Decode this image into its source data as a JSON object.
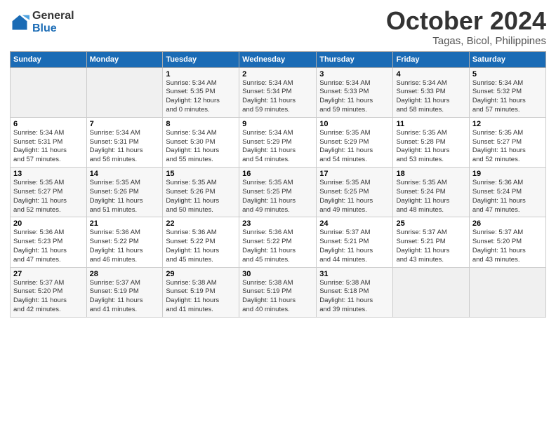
{
  "logo": {
    "general": "General",
    "blue": "Blue"
  },
  "header": {
    "month_title": "October 2024",
    "location": "Tagas, Bicol, Philippines"
  },
  "columns": [
    "Sunday",
    "Monday",
    "Tuesday",
    "Wednesday",
    "Thursday",
    "Friday",
    "Saturday"
  ],
  "weeks": [
    [
      {
        "day": "",
        "detail": ""
      },
      {
        "day": "",
        "detail": ""
      },
      {
        "day": "1",
        "detail": "Sunrise: 5:34 AM\nSunset: 5:35 PM\nDaylight: 12 hours\nand 0 minutes."
      },
      {
        "day": "2",
        "detail": "Sunrise: 5:34 AM\nSunset: 5:34 PM\nDaylight: 11 hours\nand 59 minutes."
      },
      {
        "day": "3",
        "detail": "Sunrise: 5:34 AM\nSunset: 5:33 PM\nDaylight: 11 hours\nand 59 minutes."
      },
      {
        "day": "4",
        "detail": "Sunrise: 5:34 AM\nSunset: 5:33 PM\nDaylight: 11 hours\nand 58 minutes."
      },
      {
        "day": "5",
        "detail": "Sunrise: 5:34 AM\nSunset: 5:32 PM\nDaylight: 11 hours\nand 57 minutes."
      }
    ],
    [
      {
        "day": "6",
        "detail": "Sunrise: 5:34 AM\nSunset: 5:31 PM\nDaylight: 11 hours\nand 57 minutes."
      },
      {
        "day": "7",
        "detail": "Sunrise: 5:34 AM\nSunset: 5:31 PM\nDaylight: 11 hours\nand 56 minutes."
      },
      {
        "day": "8",
        "detail": "Sunrise: 5:34 AM\nSunset: 5:30 PM\nDaylight: 11 hours\nand 55 minutes."
      },
      {
        "day": "9",
        "detail": "Sunrise: 5:34 AM\nSunset: 5:29 PM\nDaylight: 11 hours\nand 54 minutes."
      },
      {
        "day": "10",
        "detail": "Sunrise: 5:35 AM\nSunset: 5:29 PM\nDaylight: 11 hours\nand 54 minutes."
      },
      {
        "day": "11",
        "detail": "Sunrise: 5:35 AM\nSunset: 5:28 PM\nDaylight: 11 hours\nand 53 minutes."
      },
      {
        "day": "12",
        "detail": "Sunrise: 5:35 AM\nSunset: 5:27 PM\nDaylight: 11 hours\nand 52 minutes."
      }
    ],
    [
      {
        "day": "13",
        "detail": "Sunrise: 5:35 AM\nSunset: 5:27 PM\nDaylight: 11 hours\nand 52 minutes."
      },
      {
        "day": "14",
        "detail": "Sunrise: 5:35 AM\nSunset: 5:26 PM\nDaylight: 11 hours\nand 51 minutes."
      },
      {
        "day": "15",
        "detail": "Sunrise: 5:35 AM\nSunset: 5:26 PM\nDaylight: 11 hours\nand 50 minutes."
      },
      {
        "day": "16",
        "detail": "Sunrise: 5:35 AM\nSunset: 5:25 PM\nDaylight: 11 hours\nand 49 minutes."
      },
      {
        "day": "17",
        "detail": "Sunrise: 5:35 AM\nSunset: 5:25 PM\nDaylight: 11 hours\nand 49 minutes."
      },
      {
        "day": "18",
        "detail": "Sunrise: 5:35 AM\nSunset: 5:24 PM\nDaylight: 11 hours\nand 48 minutes."
      },
      {
        "day": "19",
        "detail": "Sunrise: 5:36 AM\nSunset: 5:24 PM\nDaylight: 11 hours\nand 47 minutes."
      }
    ],
    [
      {
        "day": "20",
        "detail": "Sunrise: 5:36 AM\nSunset: 5:23 PM\nDaylight: 11 hours\nand 47 minutes."
      },
      {
        "day": "21",
        "detail": "Sunrise: 5:36 AM\nSunset: 5:22 PM\nDaylight: 11 hours\nand 46 minutes."
      },
      {
        "day": "22",
        "detail": "Sunrise: 5:36 AM\nSunset: 5:22 PM\nDaylight: 11 hours\nand 45 minutes."
      },
      {
        "day": "23",
        "detail": "Sunrise: 5:36 AM\nSunset: 5:22 PM\nDaylight: 11 hours\nand 45 minutes."
      },
      {
        "day": "24",
        "detail": "Sunrise: 5:37 AM\nSunset: 5:21 PM\nDaylight: 11 hours\nand 44 minutes."
      },
      {
        "day": "25",
        "detail": "Sunrise: 5:37 AM\nSunset: 5:21 PM\nDaylight: 11 hours\nand 43 minutes."
      },
      {
        "day": "26",
        "detail": "Sunrise: 5:37 AM\nSunset: 5:20 PM\nDaylight: 11 hours\nand 43 minutes."
      }
    ],
    [
      {
        "day": "27",
        "detail": "Sunrise: 5:37 AM\nSunset: 5:20 PM\nDaylight: 11 hours\nand 42 minutes."
      },
      {
        "day": "28",
        "detail": "Sunrise: 5:37 AM\nSunset: 5:19 PM\nDaylight: 11 hours\nand 41 minutes."
      },
      {
        "day": "29",
        "detail": "Sunrise: 5:38 AM\nSunset: 5:19 PM\nDaylight: 11 hours\nand 41 minutes."
      },
      {
        "day": "30",
        "detail": "Sunrise: 5:38 AM\nSunset: 5:19 PM\nDaylight: 11 hours\nand 40 minutes."
      },
      {
        "day": "31",
        "detail": "Sunrise: 5:38 AM\nSunset: 5:18 PM\nDaylight: 11 hours\nand 39 minutes."
      },
      {
        "day": "",
        "detail": ""
      },
      {
        "day": "",
        "detail": ""
      }
    ]
  ]
}
